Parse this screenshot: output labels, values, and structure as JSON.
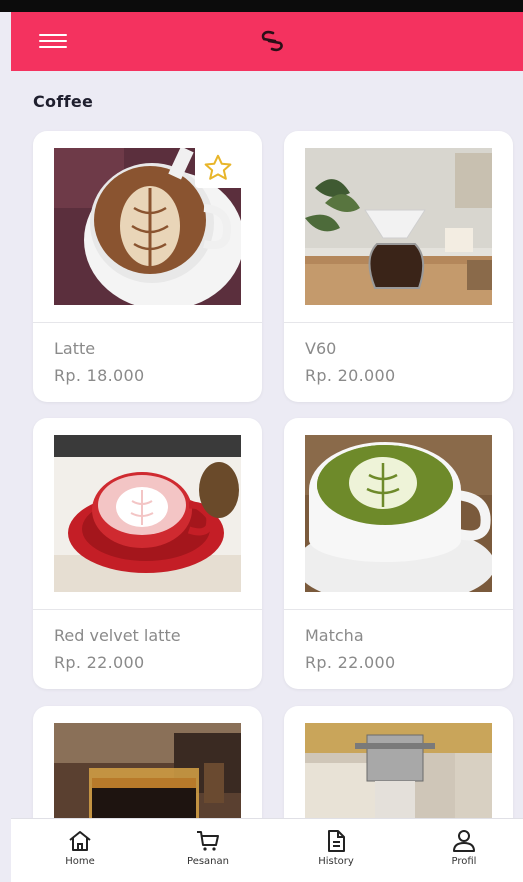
{
  "app": {
    "accent": "#F4325F"
  },
  "header": {
    "menu_icon": "menu-icon",
    "logo_icon": "link-logo-icon"
  },
  "section": {
    "title": "Coffee"
  },
  "products": [
    {
      "name": "Latte",
      "price": "Rp. 18.000",
      "favorite_icon": "star-icon"
    },
    {
      "name": "V60",
      "price": "Rp. 20.000"
    },
    {
      "name": "Red velvet latte",
      "price": "Rp. 22.000"
    },
    {
      "name": "Matcha",
      "price": "Rp. 22.000"
    },
    {
      "name": "",
      "price": ""
    },
    {
      "name": "",
      "price": ""
    }
  ],
  "bottom_nav": [
    {
      "label": "Home",
      "icon": "home-icon"
    },
    {
      "label": "Pesanan",
      "icon": "cart-icon"
    },
    {
      "label": "History",
      "icon": "document-icon"
    },
    {
      "label": "Profil",
      "icon": "user-icon"
    }
  ]
}
